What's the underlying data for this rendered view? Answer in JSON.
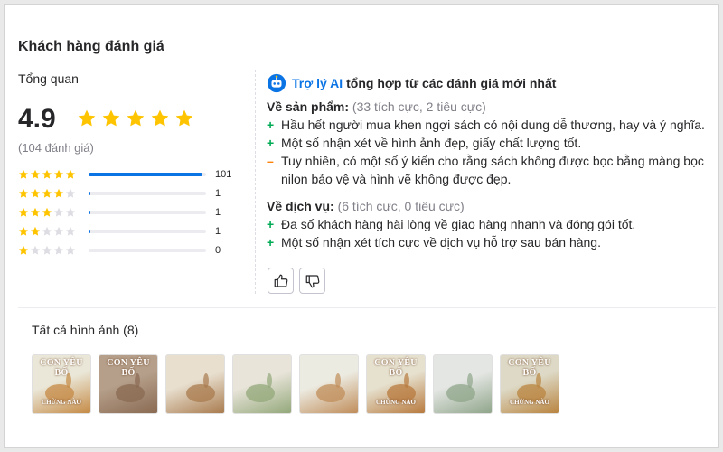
{
  "section_title": "Khách hàng đánh giá",
  "overview_label": "Tổng quan",
  "rating": {
    "score": "4.9",
    "score_value": 4.9,
    "review_count": "(104 đánh giá)",
    "breakdown": [
      {
        "stars": 5,
        "count": "101",
        "fraction": 0.971
      },
      {
        "stars": 4,
        "count": "1",
        "fraction": 0.01
      },
      {
        "stars": 3,
        "count": "1",
        "fraction": 0.01
      },
      {
        "stars": 2,
        "count": "1",
        "fraction": 0.01
      },
      {
        "stars": 1,
        "count": "0",
        "fraction": 0
      }
    ]
  },
  "ai_summary": {
    "link_label": "Trợ lý AI",
    "heading_rest": "tổng hợp từ các đánh giá mới nhất",
    "product": {
      "title": "Về sản phẩm:",
      "subtitle": "(33 tích cực, 2 tiêu cực)",
      "items": [
        {
          "sign": "+",
          "type": "pos",
          "text": "Hầu hết người mua khen ngợi sách có nội dung dễ thương, hay và ý nghĩa."
        },
        {
          "sign": "+",
          "type": "pos",
          "text": "Một số nhận xét về hình ảnh đẹp, giấy chất lượng tốt."
        },
        {
          "sign": "–",
          "type": "neg",
          "text": "Tuy nhiên, có một số ý kiến cho rằng sách không được bọc bằng màng bọc nilon bảo vệ và hình vẽ không được đẹp."
        }
      ]
    },
    "service": {
      "title": "Về dịch vụ:",
      "subtitle": "(6 tích cực, 0 tiêu cực)",
      "items": [
        {
          "sign": "+",
          "type": "pos",
          "text": "Đa số khách hàng hài lòng về giao hàng nhanh và đóng gói tốt."
        },
        {
          "sign": "+",
          "type": "pos",
          "text": "Một số nhận xét tích cực về dịch vụ hỗ trợ sau bán hàng."
        }
      ]
    },
    "icons": [
      "thumbs-up-icon",
      "thumbs-down-icon"
    ]
  },
  "gallery": {
    "title": "Tất cả hình ảnh (8)",
    "photos": [
      {
        "cover_title": "CON YÊU BỐ",
        "cover_sub": "CHỪNG NÀO",
        "colors": [
          "#eae7d8",
          "#c58a45"
        ]
      },
      {
        "cover_title": "CON YÊU BỐ",
        "cover_sub": "",
        "colors": [
          "#b59f8a",
          "#8a6a52"
        ]
      },
      {
        "cover_title": "",
        "cover_sub": "",
        "colors": [
          "#e8dfcf",
          "#a97b4e"
        ]
      },
      {
        "cover_title": "",
        "cover_sub": "",
        "colors": [
          "#e8e4d9",
          "#93a87a"
        ]
      },
      {
        "cover_title": "",
        "cover_sub": "",
        "colors": [
          "#ecebe2",
          "#c08d5a"
        ]
      },
      {
        "cover_title": "CON YÊU BỐ",
        "cover_sub": "CHỪNG NÀO",
        "colors": [
          "#e6e1cf",
          "#b87a3e"
        ]
      },
      {
        "cover_title": "",
        "cover_sub": "",
        "colors": [
          "#e4e6e3",
          "#8fa58a"
        ]
      },
      {
        "cover_title": "CON YÊU BỐ",
        "cover_sub": "CHỪNG NÀO",
        "colors": [
          "#ddd9c6",
          "#b9843f"
        ]
      }
    ]
  },
  "colors": {
    "star": "#ffc400",
    "star_empty": "#dddde3",
    "accent": "#0b74e5",
    "positive": "#00ab56",
    "negative": "#fc820a"
  }
}
